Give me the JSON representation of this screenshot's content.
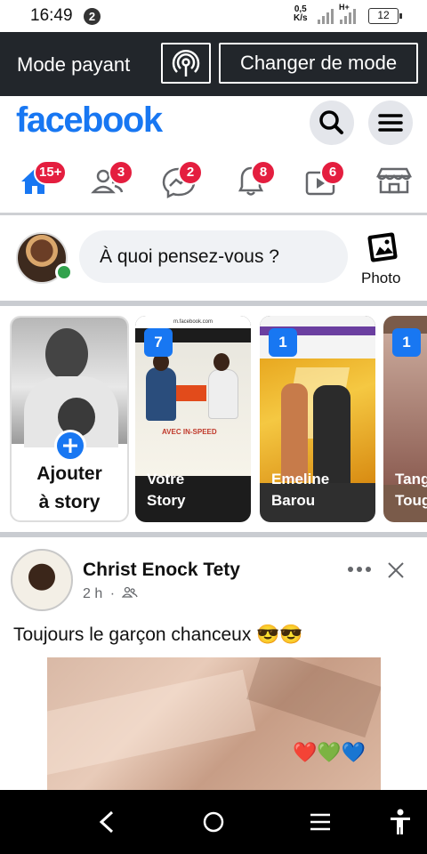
{
  "status": {
    "time": "16:49",
    "notification_count": "2",
    "speed_value": "0,5",
    "speed_unit": "K/s",
    "network_type": "H+",
    "battery": "12"
  },
  "mode_bar": {
    "label": "Mode payant",
    "change_button": "Changer de mode",
    "icon": "broadcast-icon"
  },
  "header": {
    "logo": "facebook",
    "search_icon": "search-icon",
    "menu_icon": "hamburger-menu-icon"
  },
  "tabs": [
    {
      "name": "home",
      "icon": "home-icon",
      "badge": "15+"
    },
    {
      "name": "friends",
      "icon": "friends-icon",
      "badge": "3"
    },
    {
      "name": "messenger",
      "icon": "messenger-icon",
      "badge": "2"
    },
    {
      "name": "notifications",
      "icon": "bell-icon",
      "badge": "8"
    },
    {
      "name": "watch",
      "icon": "video-icon",
      "badge": "6"
    },
    {
      "name": "marketplace",
      "icon": "store-icon",
      "badge": ""
    }
  ],
  "composer": {
    "placeholder": "À quoi pensez-vous ?",
    "photo_label": "Photo"
  },
  "stories": {
    "add_line1": "Ajouter",
    "add_line2": "à story",
    "items": [
      {
        "name_line1": "Votre",
        "name_line2": "Story",
        "count": "7",
        "preview_url": "m.facebook.com",
        "preview_headline": "AVEC IN-SPEED"
      },
      {
        "name_line1": "Emeline",
        "name_line2": "Barou",
        "count": "1"
      },
      {
        "name_line1": "Tang",
        "name_line2": "Toug",
        "count": "1"
      }
    ]
  },
  "post": {
    "author": "Christ Enock Tety",
    "time": "2 h",
    "separator": "·",
    "audience_icon": "friends-audience-icon",
    "text": "Toujours le garçon chanceux 😎😎",
    "image_emoji": "❤️💚💙"
  },
  "colors": {
    "brand": "#1877f2",
    "badge": "#e41e3f",
    "mode_bar": "#22262b",
    "online": "#31a24c"
  }
}
